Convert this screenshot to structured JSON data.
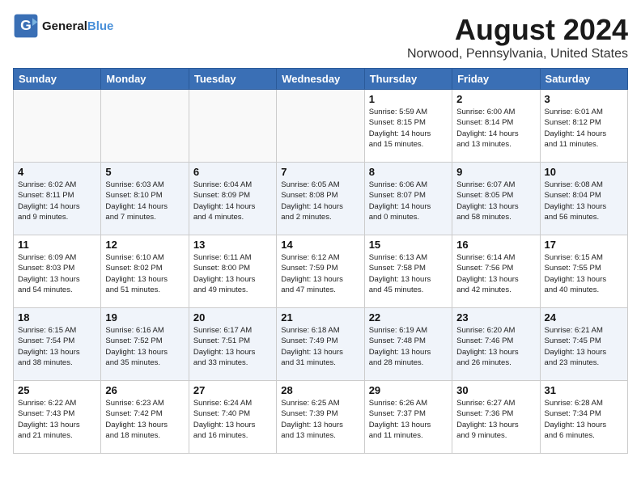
{
  "header": {
    "logo_line1": "General",
    "logo_line2": "Blue",
    "month_year": "August 2024",
    "location": "Norwood, Pennsylvania, United States"
  },
  "weekdays": [
    "Sunday",
    "Monday",
    "Tuesday",
    "Wednesday",
    "Thursday",
    "Friday",
    "Saturday"
  ],
  "weeks": [
    [
      {
        "day": "",
        "info": ""
      },
      {
        "day": "",
        "info": ""
      },
      {
        "day": "",
        "info": ""
      },
      {
        "day": "",
        "info": ""
      },
      {
        "day": "1",
        "info": "Sunrise: 5:59 AM\nSunset: 8:15 PM\nDaylight: 14 hours\nand 15 minutes."
      },
      {
        "day": "2",
        "info": "Sunrise: 6:00 AM\nSunset: 8:14 PM\nDaylight: 14 hours\nand 13 minutes."
      },
      {
        "day": "3",
        "info": "Sunrise: 6:01 AM\nSunset: 8:12 PM\nDaylight: 14 hours\nand 11 minutes."
      }
    ],
    [
      {
        "day": "4",
        "info": "Sunrise: 6:02 AM\nSunset: 8:11 PM\nDaylight: 14 hours\nand 9 minutes."
      },
      {
        "day": "5",
        "info": "Sunrise: 6:03 AM\nSunset: 8:10 PM\nDaylight: 14 hours\nand 7 minutes."
      },
      {
        "day": "6",
        "info": "Sunrise: 6:04 AM\nSunset: 8:09 PM\nDaylight: 14 hours\nand 4 minutes."
      },
      {
        "day": "7",
        "info": "Sunrise: 6:05 AM\nSunset: 8:08 PM\nDaylight: 14 hours\nand 2 minutes."
      },
      {
        "day": "8",
        "info": "Sunrise: 6:06 AM\nSunset: 8:07 PM\nDaylight: 14 hours\nand 0 minutes."
      },
      {
        "day": "9",
        "info": "Sunrise: 6:07 AM\nSunset: 8:05 PM\nDaylight: 13 hours\nand 58 minutes."
      },
      {
        "day": "10",
        "info": "Sunrise: 6:08 AM\nSunset: 8:04 PM\nDaylight: 13 hours\nand 56 minutes."
      }
    ],
    [
      {
        "day": "11",
        "info": "Sunrise: 6:09 AM\nSunset: 8:03 PM\nDaylight: 13 hours\nand 54 minutes."
      },
      {
        "day": "12",
        "info": "Sunrise: 6:10 AM\nSunset: 8:02 PM\nDaylight: 13 hours\nand 51 minutes."
      },
      {
        "day": "13",
        "info": "Sunrise: 6:11 AM\nSunset: 8:00 PM\nDaylight: 13 hours\nand 49 minutes."
      },
      {
        "day": "14",
        "info": "Sunrise: 6:12 AM\nSunset: 7:59 PM\nDaylight: 13 hours\nand 47 minutes."
      },
      {
        "day": "15",
        "info": "Sunrise: 6:13 AM\nSunset: 7:58 PM\nDaylight: 13 hours\nand 45 minutes."
      },
      {
        "day": "16",
        "info": "Sunrise: 6:14 AM\nSunset: 7:56 PM\nDaylight: 13 hours\nand 42 minutes."
      },
      {
        "day": "17",
        "info": "Sunrise: 6:15 AM\nSunset: 7:55 PM\nDaylight: 13 hours\nand 40 minutes."
      }
    ],
    [
      {
        "day": "18",
        "info": "Sunrise: 6:15 AM\nSunset: 7:54 PM\nDaylight: 13 hours\nand 38 minutes."
      },
      {
        "day": "19",
        "info": "Sunrise: 6:16 AM\nSunset: 7:52 PM\nDaylight: 13 hours\nand 35 minutes."
      },
      {
        "day": "20",
        "info": "Sunrise: 6:17 AM\nSunset: 7:51 PM\nDaylight: 13 hours\nand 33 minutes."
      },
      {
        "day": "21",
        "info": "Sunrise: 6:18 AM\nSunset: 7:49 PM\nDaylight: 13 hours\nand 31 minutes."
      },
      {
        "day": "22",
        "info": "Sunrise: 6:19 AM\nSunset: 7:48 PM\nDaylight: 13 hours\nand 28 minutes."
      },
      {
        "day": "23",
        "info": "Sunrise: 6:20 AM\nSunset: 7:46 PM\nDaylight: 13 hours\nand 26 minutes."
      },
      {
        "day": "24",
        "info": "Sunrise: 6:21 AM\nSunset: 7:45 PM\nDaylight: 13 hours\nand 23 minutes."
      }
    ],
    [
      {
        "day": "25",
        "info": "Sunrise: 6:22 AM\nSunset: 7:43 PM\nDaylight: 13 hours\nand 21 minutes."
      },
      {
        "day": "26",
        "info": "Sunrise: 6:23 AM\nSunset: 7:42 PM\nDaylight: 13 hours\nand 18 minutes."
      },
      {
        "day": "27",
        "info": "Sunrise: 6:24 AM\nSunset: 7:40 PM\nDaylight: 13 hours\nand 16 minutes."
      },
      {
        "day": "28",
        "info": "Sunrise: 6:25 AM\nSunset: 7:39 PM\nDaylight: 13 hours\nand 13 minutes."
      },
      {
        "day": "29",
        "info": "Sunrise: 6:26 AM\nSunset: 7:37 PM\nDaylight: 13 hours\nand 11 minutes."
      },
      {
        "day": "30",
        "info": "Sunrise: 6:27 AM\nSunset: 7:36 PM\nDaylight: 13 hours\nand 9 minutes."
      },
      {
        "day": "31",
        "info": "Sunrise: 6:28 AM\nSunset: 7:34 PM\nDaylight: 13 hours\nand 6 minutes."
      }
    ]
  ]
}
